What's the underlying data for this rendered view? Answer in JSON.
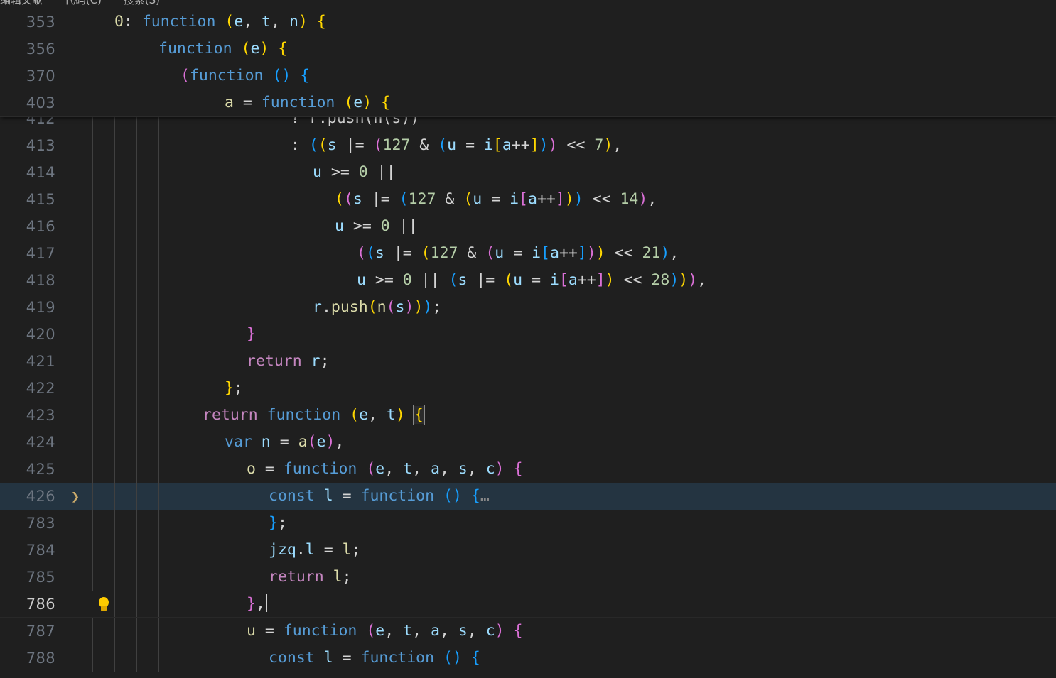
{
  "menubar": {
    "items": [
      "编辑文献",
      "代码(C)",
      "搜索(S)"
    ],
    "chevron_positions": [
      712,
      910
    ],
    "chevron_color": "#b07fd4"
  },
  "editor": {
    "language": "javascript",
    "theme": "Dark Modern",
    "background": "#1f1f1f",
    "active_line": 786,
    "folded_line": 426,
    "cursor_line": 786,
    "cursor_text_after": "},"
  },
  "sticky_scroll": {
    "lines": [
      {
        "number": "353",
        "indent": 1,
        "text": "0: function (e, t, n) {"
      },
      {
        "number": "356",
        "indent": 2,
        "text": "function (e) {"
      },
      {
        "number": "370",
        "indent": 3,
        "text": "(function () {"
      },
      {
        "number": "403",
        "indent": 4,
        "text": "a = function (e) {"
      }
    ]
  },
  "code_lines": [
    {
      "number": "412",
      "text": "? r.push(n(s))",
      "clipped": true
    },
    {
      "number": "413",
      "text": ": ((s |= (127 & (u = i[a++])) << 7),"
    },
    {
      "number": "414",
      "text": "u >= 0 ||"
    },
    {
      "number": "415",
      "text": "((s |= (127 & (u = i[a++])) << 14),"
    },
    {
      "number": "416",
      "text": "u >= 0 ||"
    },
    {
      "number": "417",
      "text": "((s |= (127 & (u = i[a++])) << 21),"
    },
    {
      "number": "418",
      "text": "u >= 0 || (s |= (u = i[a++]) << 28))),"
    },
    {
      "number": "419",
      "text": "r.push(n(s)));"
    },
    {
      "number": "420",
      "text": "}"
    },
    {
      "number": "421",
      "text": "return r;"
    },
    {
      "number": "422",
      "text": "};"
    },
    {
      "number": "423",
      "text": "return function (e, t) {"
    },
    {
      "number": "424",
      "text": "var n = a(e),"
    },
    {
      "number": "425",
      "text": "o = function (e, t, a, s, c) {"
    },
    {
      "number": "426",
      "text": "const l = function () {…",
      "folded": true
    },
    {
      "number": "783",
      "text": "};"
    },
    {
      "number": "784",
      "text": "jzq.l = l;"
    },
    {
      "number": "785",
      "text": "return l;"
    },
    {
      "number": "786",
      "text": "},",
      "active": true
    },
    {
      "number": "787",
      "text": "u = function (e, t, a, s, c) {"
    },
    {
      "number": "788",
      "text": "const l = function () {"
    }
  ],
  "gutter": {
    "fold_chevron": "❯",
    "lightbulb": "lightbulb-icon"
  },
  "colors": {
    "keyword": "#c586c0",
    "keyword_blue": "#569cd6",
    "function": "#dcdcaa",
    "variable": "#9cdcfe",
    "number": "#b5cea8",
    "plain": "#d4d4d4",
    "bracket_1": "#ffd700",
    "bracket_2": "#da70d6",
    "bracket_3": "#179fff",
    "folded_line_bg": "#243441",
    "gutter_fg": "#6e7681"
  }
}
